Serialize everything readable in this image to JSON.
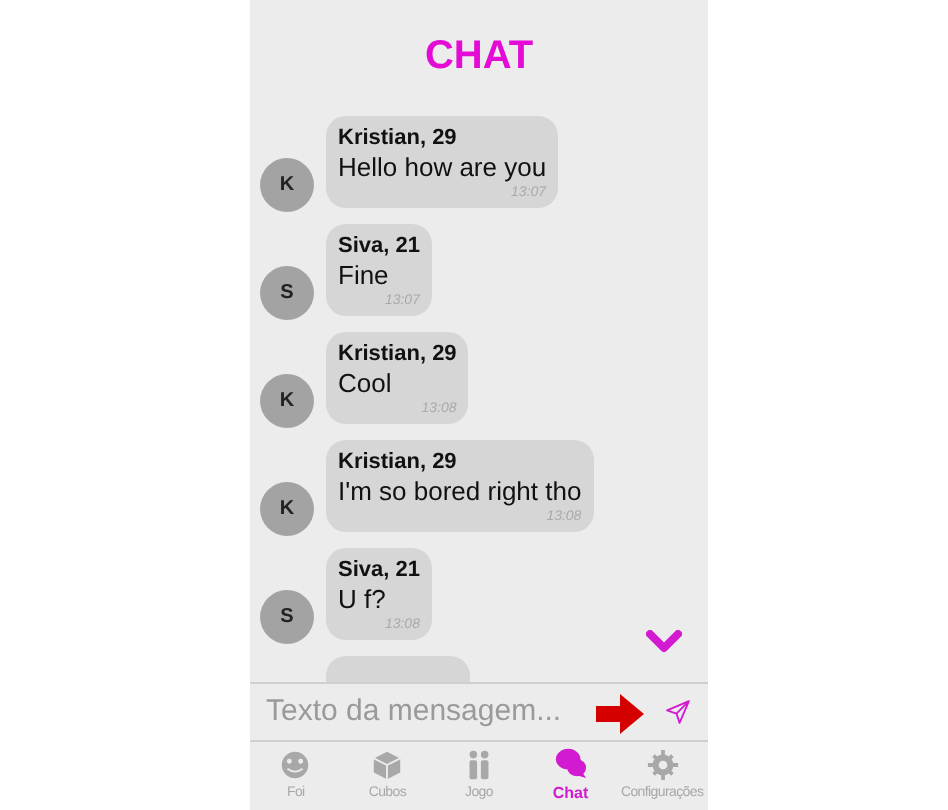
{
  "header": {
    "title": "CHAT"
  },
  "messages": [
    {
      "sender": "Kristian, 29",
      "initial": "K",
      "text": "Hello how are you",
      "time": "13:07"
    },
    {
      "sender": "Siva, 21",
      "initial": "S",
      "text": "Fine",
      "time": "13:07"
    },
    {
      "sender": "Kristian, 29",
      "initial": "K",
      "text": "Cool",
      "time": "13:08"
    },
    {
      "sender": "Kristian, 29",
      "initial": "K",
      "text": "I'm so bored right tho",
      "time": "13:08"
    },
    {
      "sender": "Siva, 21",
      "initial": "S",
      "text": "U f?",
      "time": "13:08"
    }
  ],
  "composer": {
    "placeholder": "Texto da mensagem..."
  },
  "tabs": [
    {
      "kind": "face",
      "label": "Foi",
      "selected": false
    },
    {
      "kind": "cube",
      "label": "Cubos",
      "selected": false
    },
    {
      "kind": "people",
      "label": "Jogo",
      "selected": false
    },
    {
      "kind": "chat",
      "label": "Chat",
      "selected": true
    },
    {
      "kind": "gear",
      "label": "Configurações",
      "selected": false
    }
  ]
}
